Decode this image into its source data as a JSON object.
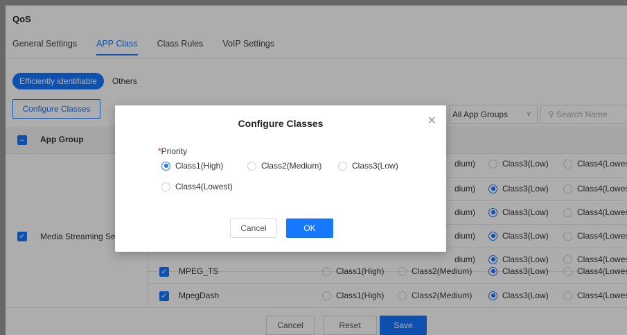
{
  "page": {
    "title": "QoS"
  },
  "tabs": [
    "General Settings",
    "APP Class",
    "Class Rules",
    "VoIP Settings"
  ],
  "pills": {
    "active": "Efficiently identifiable",
    "other": "Others"
  },
  "toolbar": {
    "configure_label": "Configure Classes",
    "group_filter": "All App Groups",
    "search_placeholder": "Search Name"
  },
  "table": {
    "header_group": "App Group",
    "group_name": "Media Streaming Se",
    "partial_rows": [
      {
        "c2": "dium)",
        "c3": "Class3(Low)",
        "c4": "Class4(Lowest"
      },
      {
        "c2": "dium)",
        "c3": "Class3(Low)",
        "c4": "Class4(Lowest"
      },
      {
        "c2": "dium)",
        "c3": "Class3(Low)",
        "c4": "Class4(Lowest"
      },
      {
        "c2": "dium)",
        "c3": "Class3(Low)",
        "c4": "Class4(Lowest"
      },
      {
        "c2": "dium)",
        "c3": "Class3(Low)",
        "c4": "Class4(Lowest"
      }
    ],
    "full_rows": [
      {
        "app": "MPEG_TS",
        "c1": "Class1(High)",
        "c2": "Class2(Medium)",
        "c3": "Class3(Low)",
        "c4": "Class4(Lowest"
      },
      {
        "app": "MpegDash",
        "c1": "Class1(High)",
        "c2": "Class2(Medium)",
        "c3": "Class3(Low)",
        "c4": "Class4(Lowest"
      }
    ]
  },
  "footer": {
    "cancel": "Cancel",
    "reset": "Reset",
    "save": "Save"
  },
  "modal": {
    "title": "Configure Classes",
    "required_mark": "*",
    "priority_label": "Priority",
    "options": [
      "Class1(High)",
      "Class2(Medium)",
      "Class3(Low)",
      "Class4(Lowest)"
    ],
    "selected": "Class1(High)",
    "cancel": "Cancel",
    "ok": "OK"
  },
  "colors": {
    "accent": "#1677ff",
    "required": "#f5222d"
  }
}
